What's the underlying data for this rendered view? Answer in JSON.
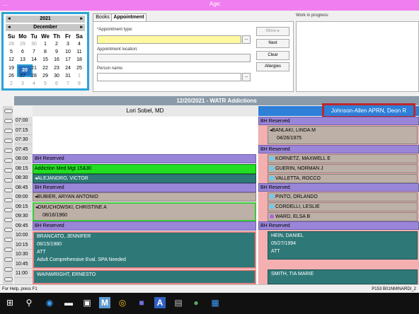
{
  "window": {
    "title": "...",
    "age_label": "Age:"
  },
  "calendar": {
    "year": "2021",
    "month": "December",
    "dow": [
      "Su",
      "Mo",
      "Tu",
      "We",
      "Th",
      "Fr",
      "Sa"
    ],
    "weeks": [
      [
        "28",
        "29",
        "30",
        "1",
        "2",
        "3",
        "4"
      ],
      [
        "5",
        "6",
        "7",
        "8",
        "9",
        "10",
        "11"
      ],
      [
        "12",
        "13",
        "14",
        "15",
        "16",
        "17",
        "18"
      ],
      [
        "19",
        "20",
        "21",
        "22",
        "23",
        "24",
        "25"
      ],
      [
        "26",
        "27",
        "28",
        "29",
        "30",
        "31",
        "1"
      ],
      [
        "2",
        "3",
        "4",
        "5",
        "6",
        "7",
        "8"
      ]
    ],
    "selected_day": "20"
  },
  "appointment_panel": {
    "tabs": [
      "Books",
      "Appointment"
    ],
    "active_tab": "Appointment",
    "appointment_type_label": "*Appointment type:",
    "appointment_location_label": "Appointment location:",
    "person_name_label": "Person name:",
    "dots_label": "...",
    "buttons": {
      "move": "Move",
      "next": "Next",
      "clear": "Clear",
      "allergies": "Allergies"
    },
    "work_in_progress_label": "Work in progress:"
  },
  "schedule": {
    "date_header": "12/20/2021 - WATR Addictions",
    "provider_left": "Lori Sobel, MD",
    "provider_right": "Johnson-Allen APRN, Deon R",
    "times": [
      "07:00",
      "07:15",
      "07:30",
      "07:45",
      "08:00",
      "08:15",
      "08:30",
      "08:45",
      "09:00",
      "09:15",
      "09:30",
      "09:45",
      "10:00",
      "10:15",
      "10:30",
      "10:45",
      "11:00"
    ],
    "left_appointments": {
      "bh_reserved_1": "BH Reserved",
      "addiction": "Addiction Med Mgt 15&30",
      "alejandro": "ALEJANDRO, VICTOR",
      "bh_reserved_2": "BH Reserved",
      "bubier": "BUBIER, ARYAN ANTONIO",
      "dmuchowski": "DMUCHOWSKI, CHRISTINE A",
      "dmuchowski_dob": "08/16/1960",
      "bh_reserved_3": "BH Reserved",
      "brancato": "BRANCATO, JENNIFER",
      "brancato_dob": "08/15/1980",
      "brancato_att": "ATT",
      "brancato_note": "Adult Comprehensive Eval. SPA Needed",
      "wainwright": "WAINWRIGHT, ERNESTO"
    },
    "right_appointments": {
      "bh_reserved_1": "BH Reserved",
      "banlaki": "BANLAKI, LINDA M",
      "banlaki_dob": "04/26/1975",
      "bh_reserved_2": "BH Reserved",
      "kornetz": "KORNETZ, MAXWELL E",
      "guerin": "GUERIN, NORMAN J",
      "valletta": "VALLETTA, ROCCO",
      "bh_reserved_3": "BH Reserved",
      "pinto": "PINTO, ORLANDO",
      "cordelli": "CORDELLI, LESLIE",
      "ward": "WARD, ELSA B",
      "bh_reserved_4": "BH Reserved",
      "hein": "HEIN, DANIEL",
      "hein_dob": "05/27/1994",
      "hein_att": "ATT",
      "smith": "SMITH, TIA MARIE"
    }
  },
  "status_bar": {
    "help": "For Help, press F1",
    "session": "P153  B01NMINARDI_2"
  },
  "taskbar": {
    "icons": [
      "windows-icon",
      "search-icon",
      "edge-icon",
      "store-icon",
      "m-app-icon",
      "chrome-icon",
      "teams-icon",
      "a-app-icon",
      "printer-icon",
      "cerner-icon",
      "chart-icon"
    ]
  }
}
